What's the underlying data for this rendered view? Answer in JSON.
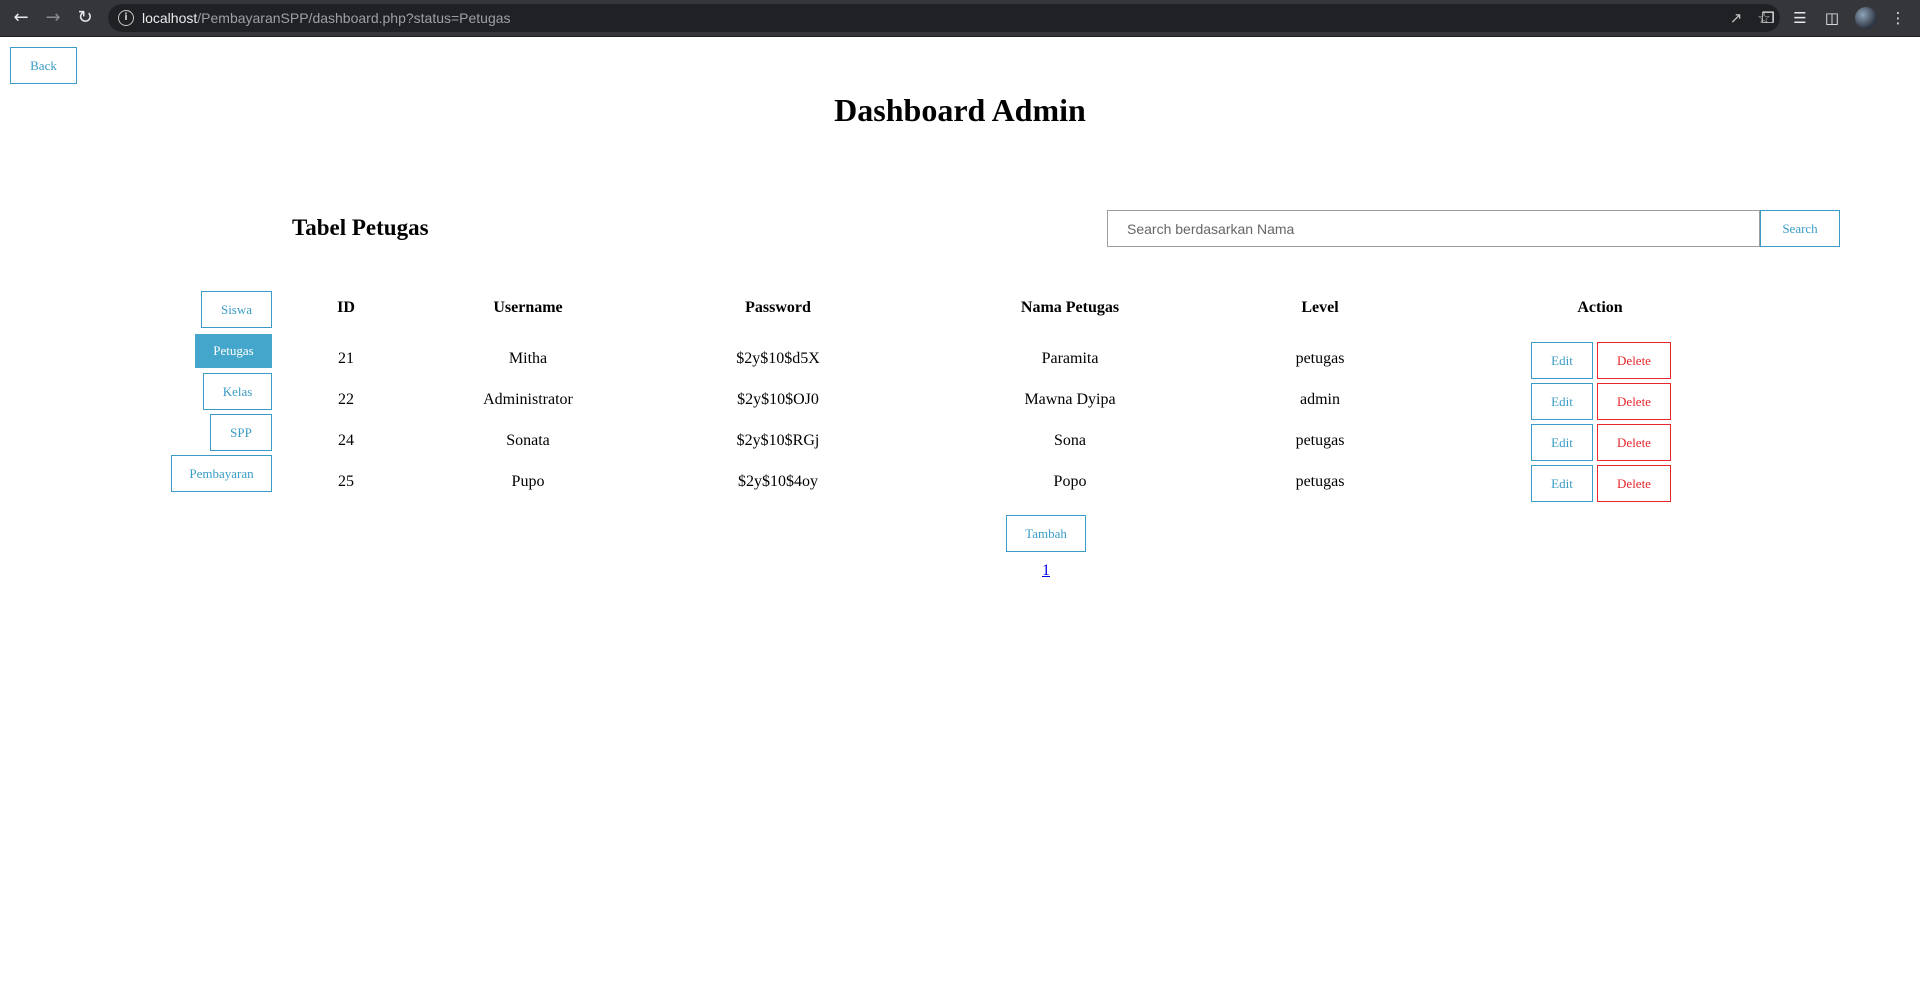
{
  "browser": {
    "url_host": "localhost",
    "url_path": "/PembayaranSPP/dashboard.php?status=Petugas"
  },
  "page": {
    "back_label": "Back",
    "title": "Dashboard Admin",
    "table_title": "Tabel Petugas"
  },
  "search": {
    "placeholder": "Search berdasarkan Nama",
    "value": "",
    "button_label": "Search"
  },
  "sidebar": {
    "items": [
      {
        "label": "Siswa",
        "active": false
      },
      {
        "label": "Petugas",
        "active": true
      },
      {
        "label": "Kelas",
        "active": false
      },
      {
        "label": "SPP",
        "active": false
      },
      {
        "label": "Pembayaran",
        "active": false
      }
    ]
  },
  "table": {
    "headers": [
      "ID",
      "Username",
      "Password",
      "Nama Petugas",
      "Level",
      "Action"
    ],
    "rows": [
      {
        "id": "21",
        "username": "Mitha",
        "password": "$2y$10$d5X",
        "nama": "Paramita",
        "level": "petugas"
      },
      {
        "id": "22",
        "username": "Administrator",
        "password": "$2y$10$OJ0",
        "nama": "Mawna Dyipa",
        "level": "admin"
      },
      {
        "id": "24",
        "username": "Sonata",
        "password": "$2y$10$RGj",
        "nama": "Sona",
        "level": "petugas"
      },
      {
        "id": "25",
        "username": "Pupo",
        "password": "$2y$10$4oy",
        "nama": "Popo",
        "level": "petugas"
      }
    ],
    "edit_label": "Edit",
    "delete_label": "Delete"
  },
  "add_label": "Tambah",
  "pagination": {
    "current": "1"
  },
  "colors": {
    "accent": "#3a9cc6",
    "active_bg": "#44a6cb",
    "danger": "#e8262b",
    "link": "#0000ee"
  }
}
